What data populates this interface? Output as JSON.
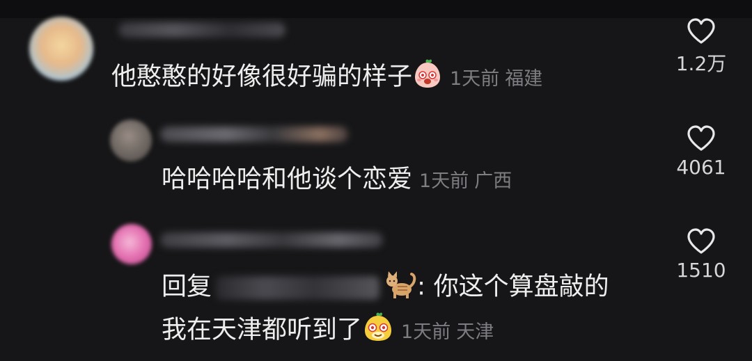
{
  "comments": [
    {
      "text": "他憨憨的好像很好骗的样子",
      "time": "1天前",
      "location": "福建",
      "likes": "1.2万"
    },
    {
      "text": "哈哈哈哈和他谈个恋爱",
      "time": "1天前",
      "location": "广西",
      "likes": "4061"
    },
    {
      "reply_prefix": "回复",
      "text_line1": ": 你这个算盘敲的",
      "text_line2": "我在天津都听到了",
      "time": "1天前",
      "location": "天津",
      "likes": "1510"
    }
  ],
  "icons": {
    "like": "heart-outline-icon",
    "emoji_1": "blushing-peach-emoji",
    "emoji_2": "cat-emoji",
    "emoji_3": "sly-face-emoji"
  }
}
